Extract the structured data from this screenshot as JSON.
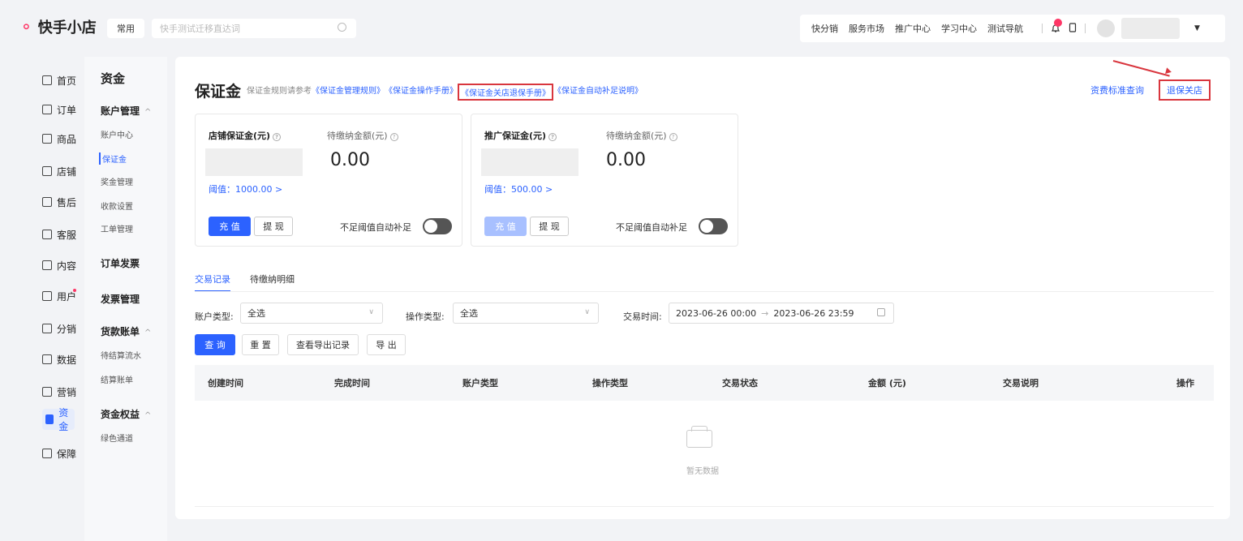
{
  "header": {
    "logo_text": "快手小店",
    "quick_tab": "常用",
    "search_placeholder": "快手测试迁移直达词",
    "nav_links": [
      "快分销",
      "服务市场",
      "推广中心",
      "学习中心",
      "测试导航"
    ]
  },
  "leftnav": {
    "items": [
      {
        "label": "首页",
        "icon": "home-icon"
      },
      {
        "label": "订单",
        "icon": "order-icon"
      },
      {
        "label": "商品",
        "icon": "product-icon"
      },
      {
        "label": "店铺",
        "icon": "store-icon"
      },
      {
        "label": "售后",
        "icon": "aftersale-icon"
      },
      {
        "label": "客服",
        "icon": "service-icon"
      },
      {
        "label": "内容",
        "icon": "content-icon"
      },
      {
        "label": "用户",
        "icon": "user-icon"
      },
      {
        "label": "分销",
        "icon": "distribution-icon"
      },
      {
        "label": "数据",
        "icon": "data-icon"
      },
      {
        "label": "营销",
        "icon": "marketing-icon"
      },
      {
        "label": "资金",
        "icon": "funds-icon"
      },
      {
        "label": "保障",
        "icon": "shield-icon"
      }
    ]
  },
  "subnav": {
    "title": "资金",
    "groups": [
      {
        "label": "账户管理",
        "chevron": "^"
      },
      {
        "label": "订单发票"
      },
      {
        "label": "发票管理"
      },
      {
        "label": "货款账单",
        "chevron": "^"
      },
      {
        "label": "资金权益",
        "chevron": "^"
      }
    ],
    "items": [
      "账户中心",
      "保证金",
      "奖金管理",
      "收款设置",
      "工单管理",
      "待结算流水",
      "结算账单",
      "绿色通道"
    ]
  },
  "main": {
    "title": "保证金",
    "ref_prefix": "保证金规则请参考",
    "ref_links": [
      "《保证金管理规则》",
      "《保证金操作手册》",
      "《保证金关店退保手册》",
      "《保证金自动补足说明》"
    ],
    "top_right_links": [
      "资费标准查询",
      "退保关店"
    ],
    "cards": [
      {
        "label": "店铺保证金(元)",
        "pending_label": "待缴纳金额(元)",
        "pending_amount": "0.00",
        "threshold": "阈值：1000.00 >",
        "recharge": "充 值",
        "withdraw": "提 现",
        "auto_label": "不足阈值自动补足"
      },
      {
        "label": "推广保证金(元)",
        "pending_label": "待缴纳金额(元)",
        "pending_amount": "0.00",
        "threshold": "阈值：500.00 >",
        "recharge": "充 值",
        "withdraw": "提 现",
        "auto_label": "不足阈值自动补足"
      }
    ],
    "tabs": [
      "交易记录",
      "待缴纳明细"
    ],
    "filters": {
      "account_type_label": "账户类型:",
      "account_type_value": "全选",
      "op_type_label": "操作类型:",
      "op_type_value": "全选",
      "time_label": "交易时间:",
      "time_start": "2023-06-26 00:00",
      "time_end": "2023-06-26 23:59"
    },
    "actions": [
      "查 询",
      "重 置",
      "查看导出记录",
      "导 出"
    ],
    "table_headers": [
      "创建时间",
      "完成时间",
      "账户类型",
      "操作类型",
      "交易状态",
      "金额 (元)",
      "交易说明",
      "操作"
    ],
    "empty_text": "暂无数据"
  },
  "colors": {
    "accent": "#2c62ff",
    "brand": "#fe3666",
    "annotation": "#d9363e"
  }
}
